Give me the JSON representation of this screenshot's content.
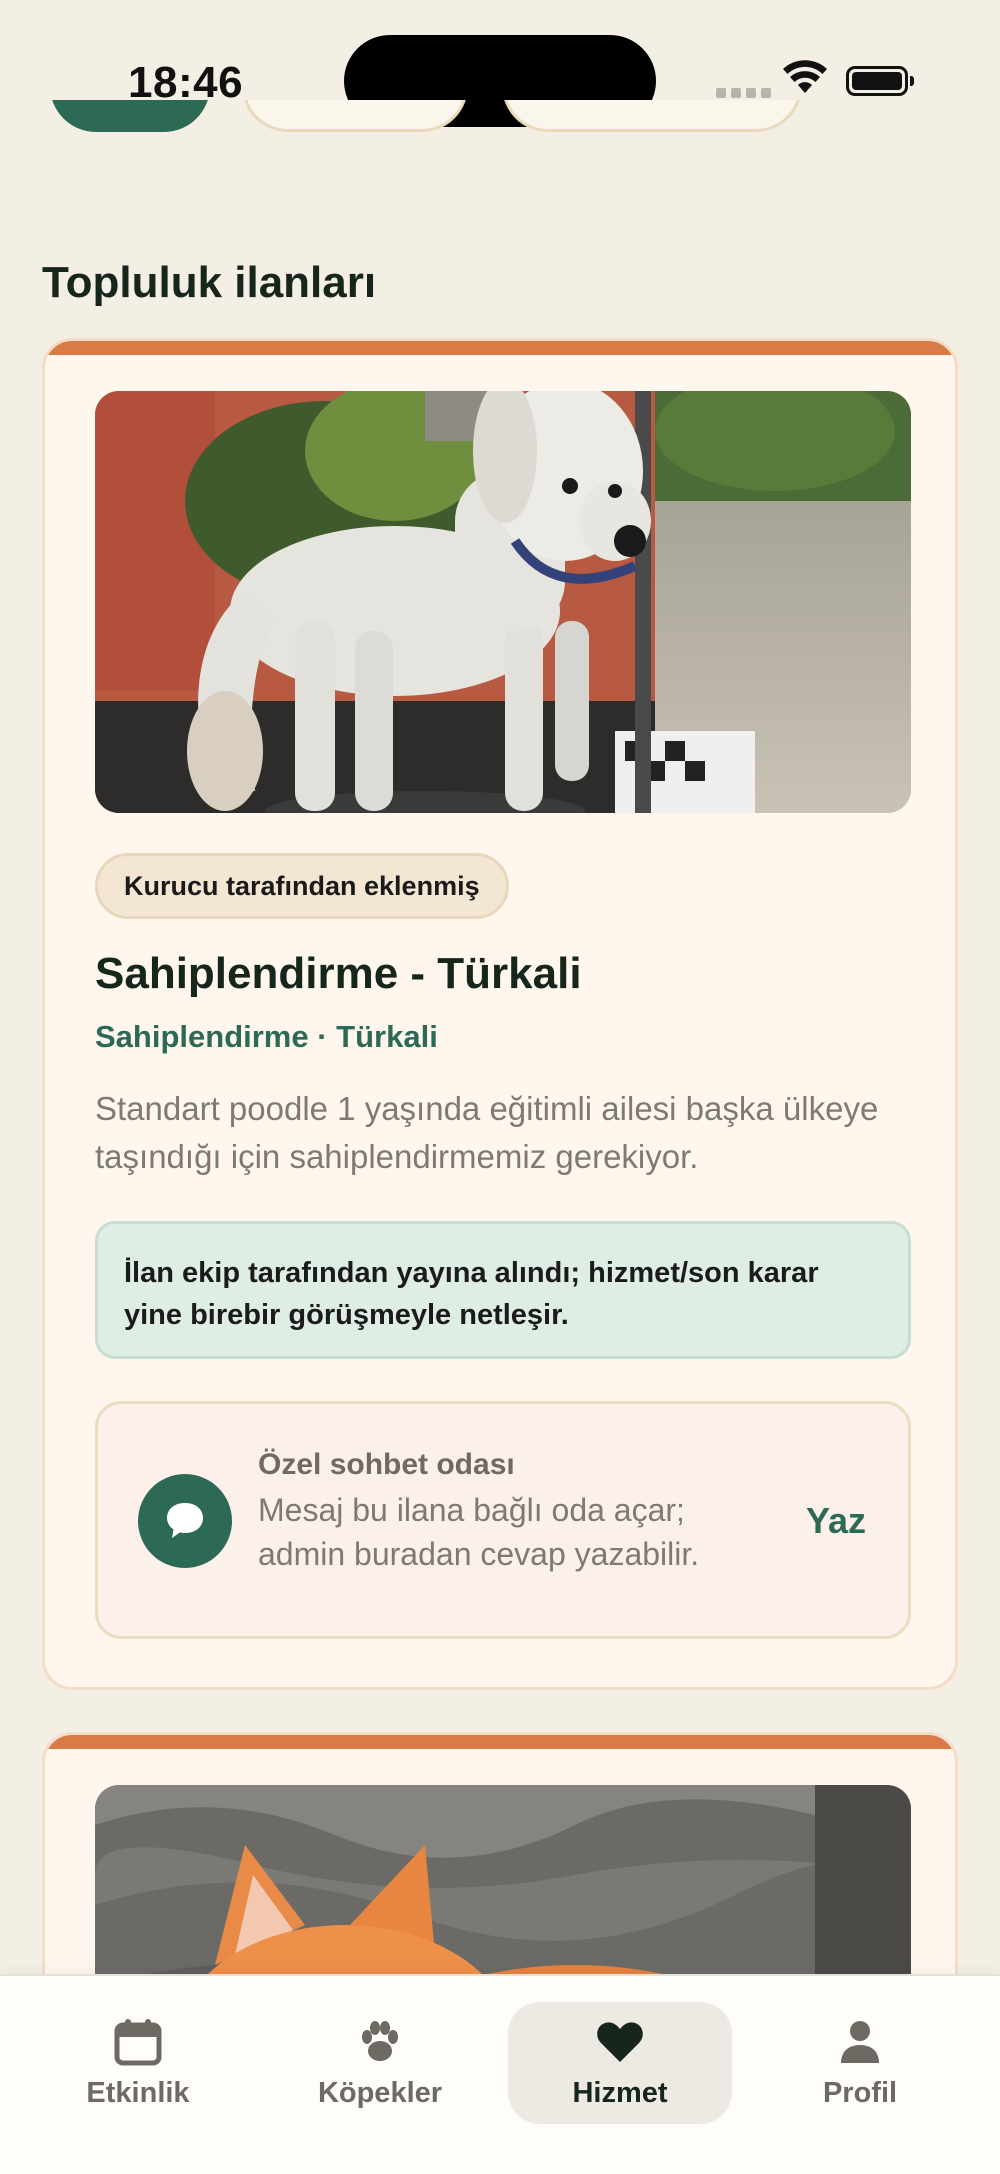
{
  "status_bar": {
    "time": "18:46"
  },
  "section": {
    "title": "Topluluk ilanları"
  },
  "listing": {
    "badge": "Kurucu tarafından eklenmiş",
    "title": "Sahiplendirme - Türkali",
    "subtitle": "Sahiplendirme · Türkali",
    "description": "Standart poodle 1 yaşında eğitimli ailesi başka ülkeye taşındığı için sahiplendirmemiz gerekiyor.",
    "notice": "İlan ekip tarafından yayına alındı; hizmet/son karar yine birebir görüşmeyle netleşir.",
    "chat": {
      "title": "Özel sohbet odası",
      "description": "Mesaj bu ilana bağlı oda açar; admin buradan cevap yazabilir.",
      "action": "Yaz",
      "icon": "chat-bubble-icon"
    }
  },
  "tab_bar": {
    "tabs": [
      {
        "label": "Etkinlik",
        "icon": "calendar-icon",
        "active": false
      },
      {
        "label": "Köpekler",
        "icon": "paw-icon",
        "active": false
      },
      {
        "label": "Hizmet",
        "icon": "heart-icon",
        "active": true
      },
      {
        "label": "Profil",
        "icon": "person-icon",
        "active": false
      }
    ]
  },
  "colors": {
    "accent": "#2d6a55",
    "card_top_border": "#d97b47",
    "background": "#f4efe4"
  }
}
